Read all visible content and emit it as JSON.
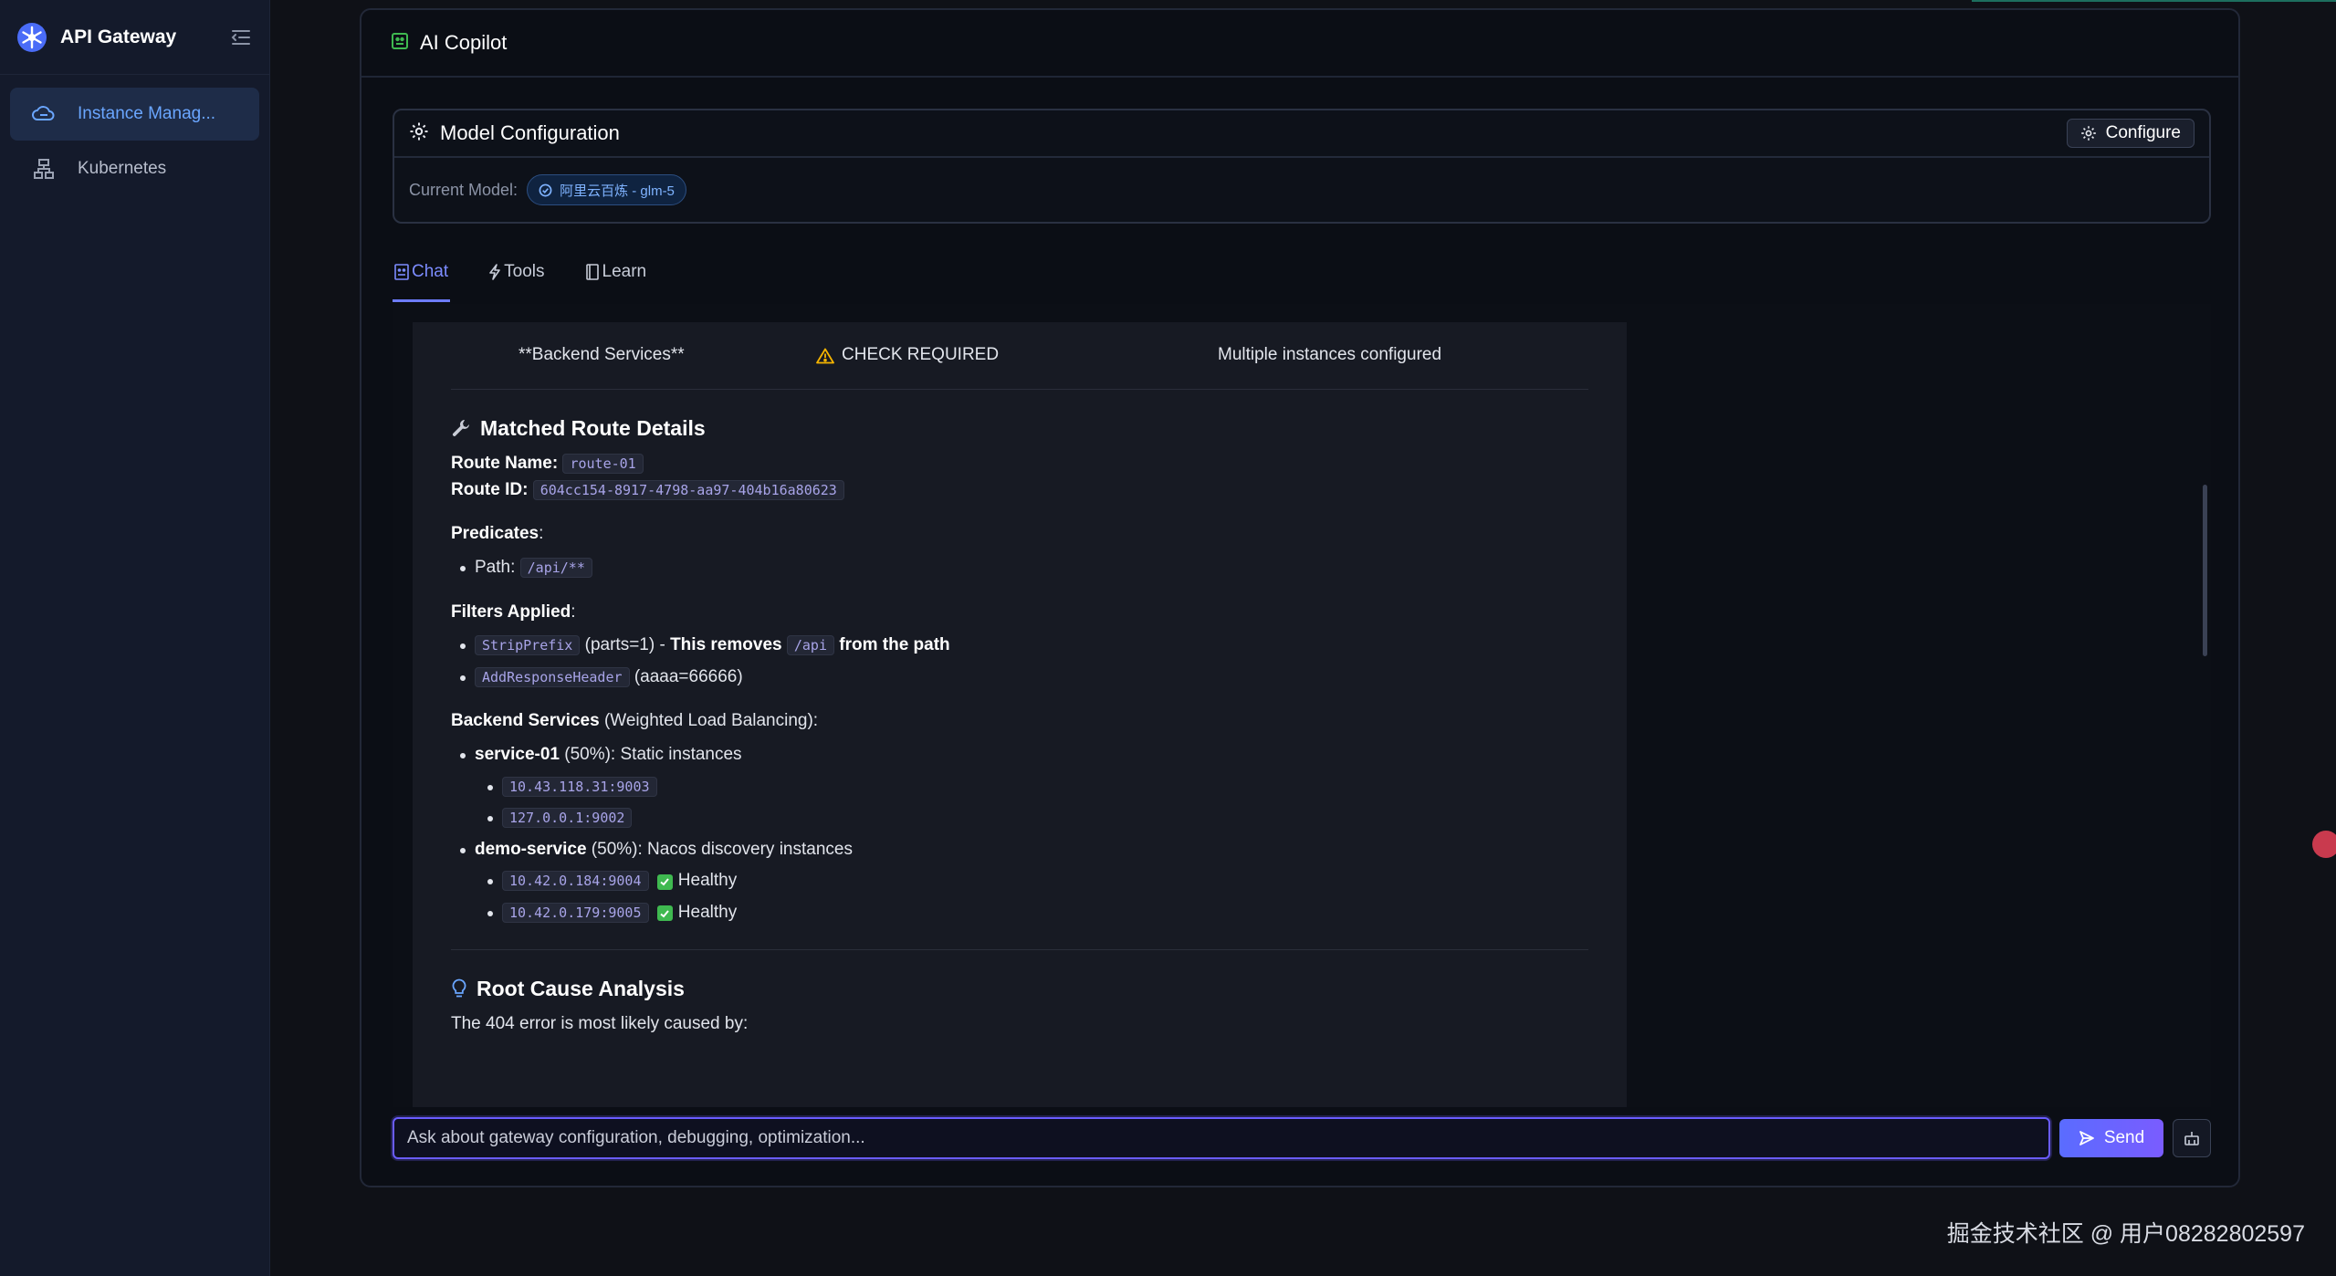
{
  "app": {
    "title": "API Gateway"
  },
  "sidebar": {
    "items": [
      {
        "label": "Instance Manag...",
        "icon": "cloud-icon",
        "active": true
      },
      {
        "label": "Kubernetes",
        "icon": "cluster-icon",
        "active": false
      }
    ]
  },
  "panel": {
    "title": "AI Copilot"
  },
  "model_config": {
    "title": "Model Configuration",
    "configure_label": "Configure",
    "current_label": "Current Model:",
    "current_model": "阿里云百炼 - glm-5"
  },
  "tabs": [
    {
      "label": "Chat",
      "active": true
    },
    {
      "label": "Tools",
      "active": false
    },
    {
      "label": "Learn",
      "active": false
    }
  ],
  "message": {
    "table_row": {
      "component": "**Backend Services**",
      "status": "CHECK REQUIRED",
      "note": "Multiple instances configured"
    },
    "route_section": {
      "title": "Matched Route Details",
      "route_name_label": "Route Name:",
      "route_name": "route-01",
      "route_id_label": "Route ID:",
      "route_id": "604cc154-8917-4798-aa97-404b16a80623",
      "predicates_label": "Predicates",
      "path_label": "Path:",
      "path_value": "/api/**",
      "filters_label": "Filters Applied",
      "filters": [
        {
          "name": "StripPrefix",
          "args": "(parts=1) - ",
          "bold_a": "This removes",
          "code": "/api",
          "bold_b": "from the path"
        },
        {
          "name": "AddResponseHeader",
          "args": "(aaaa=66666)"
        }
      ],
      "backend_label": "Backend Services",
      "backend_note": "(Weighted Load Balancing):",
      "services": [
        {
          "name": "service-01",
          "desc": "(50%): Static instances",
          "instances": [
            {
              "addr": "10.43.118.31:9003",
              "health": ""
            },
            {
              "addr": "127.0.0.1:9002",
              "health": ""
            }
          ]
        },
        {
          "name": "demo-service",
          "desc": "(50%): Nacos discovery instances",
          "instances": [
            {
              "addr": "10.42.0.184:9004",
              "health": "Healthy"
            },
            {
              "addr": "10.42.0.179:9005",
              "health": "Healthy"
            }
          ]
        }
      ]
    },
    "root_cause": {
      "title": "Root Cause Analysis",
      "intro": "The 404 error is most likely caused by:"
    }
  },
  "input": {
    "placeholder": "Ask about gateway configuration, debugging, optimization...",
    "send_label": "Send"
  },
  "watermark": "掘金技术社区 @ 用户08282802597",
  "colors": {
    "accent": "#6d7cff",
    "active_nav": "#6aa6ff",
    "healthy": "#3fb950",
    "warning": "#f5b400"
  }
}
